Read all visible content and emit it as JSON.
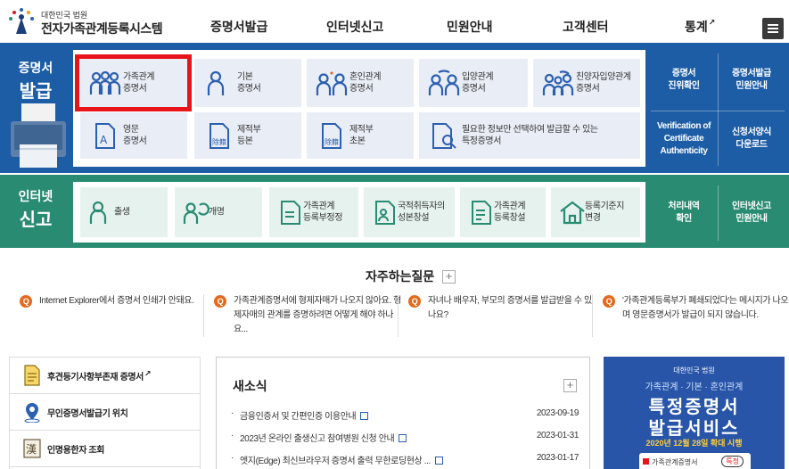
{
  "logo": {
    "org": "대한민국 법원",
    "name": "전자가족관계등록시스템"
  },
  "nav": [
    {
      "label": "증명서발급"
    },
    {
      "label": "인터넷신고"
    },
    {
      "label": "민원안내"
    },
    {
      "label": "고객센터"
    },
    {
      "label": "통계"
    }
  ],
  "cert": {
    "title_line1": "증명서",
    "title_line2": "발급",
    "tiles": [
      {
        "line1": "가족관계",
        "line2": "증명서"
      },
      {
        "line1": "기본",
        "line2": "증명서"
      },
      {
        "line1": "혼인관계",
        "line2": "증명서"
      },
      {
        "line1": "입양관계",
        "line2": "증명서"
      },
      {
        "line1": "친양자입양관계",
        "line2": "증명서"
      },
      {
        "line1": "영문",
        "line2": "증명서"
      },
      {
        "line1": "제적부",
        "line2": "등본"
      },
      {
        "line1": "제적부",
        "line2": "초본"
      },
      {
        "line1": "필요한 정보만 선택하여 발급할 수 있는",
        "line2": "특정증명서"
      }
    ],
    "side_links": [
      {
        "line1": "증명서",
        "line2": "진위확인"
      },
      {
        "line1": "증명서발급",
        "line2": "민원안내"
      },
      {
        "line1": "Verification of",
        "line2": "Certificate",
        "line3": "Authenticity"
      },
      {
        "line1": "신청서양식",
        "line2": "다운로드"
      }
    ]
  },
  "report": {
    "title_line1": "인터넷",
    "title_line2": "신고",
    "tiles": [
      {
        "line1": "출생",
        "line2": ""
      },
      {
        "line1": "개명",
        "line2": ""
      },
      {
        "line1": "가족관계",
        "line2": "등록부정정"
      },
      {
        "line1": "국적취득자의",
        "line2": "성본창설"
      },
      {
        "line1": "가족관계",
        "line2": "등록창설"
      },
      {
        "line1": "등록기준지",
        "line2": "변경"
      }
    ],
    "side_links": [
      {
        "line1": "처리내역",
        "line2": "확인"
      },
      {
        "line1": "인터넷신고",
        "line2": "민원안내"
      }
    ]
  },
  "faq": {
    "title": "자주하는질문",
    "items": [
      {
        "text": "Internet Explorer에서 증명서 인쇄가 안돼요."
      },
      {
        "text": "가족관계증명서에 형제자매가 나오지 않아요. 형제자매의 관계를 증명하려면 어떻게 해야 하나요..."
      },
      {
        "text": "자녀나 배우자, 부모의 증명서를 발급받을 수 있나요?"
      },
      {
        "text": "'가족관계등록부가 폐쇄되었다'는 메시지가 나오며 영문증명서가 발급이 되지 않습니다."
      }
    ]
  },
  "quick": [
    {
      "label": "후견등기사항부존재 증명서"
    },
    {
      "label": "무인증명서발급기 위치"
    },
    {
      "label": "인명용한자 조회"
    }
  ],
  "news": {
    "title": "새소식",
    "items": [
      {
        "title": "금융인증서 및 간편인증 이용안내",
        "date": "2023-09-19"
      },
      {
        "title": "2023년 온라인 출생신고 참여병원 신청 안내",
        "date": "2023-01-31"
      },
      {
        "title": "엣지(Edge) 최신브라우저 증명서 출력 무한로딩현상 ...",
        "date": "2023-01-17"
      }
    ]
  },
  "banner": {
    "org": "대한민국 법원",
    "sub": "가족관계 · 기본 · 혼인관계",
    "line1": "특정증명서",
    "line2": "발급서비스",
    "note": "2020년 12월 28일 확대 시행",
    "card": "가족관계증명서",
    "pill": "특정"
  },
  "colors": {
    "cert_band": "#1d5da6",
    "report_band": "#2a8b73",
    "highlight": "#e8141c",
    "faq_icon": "#e46a1e"
  }
}
